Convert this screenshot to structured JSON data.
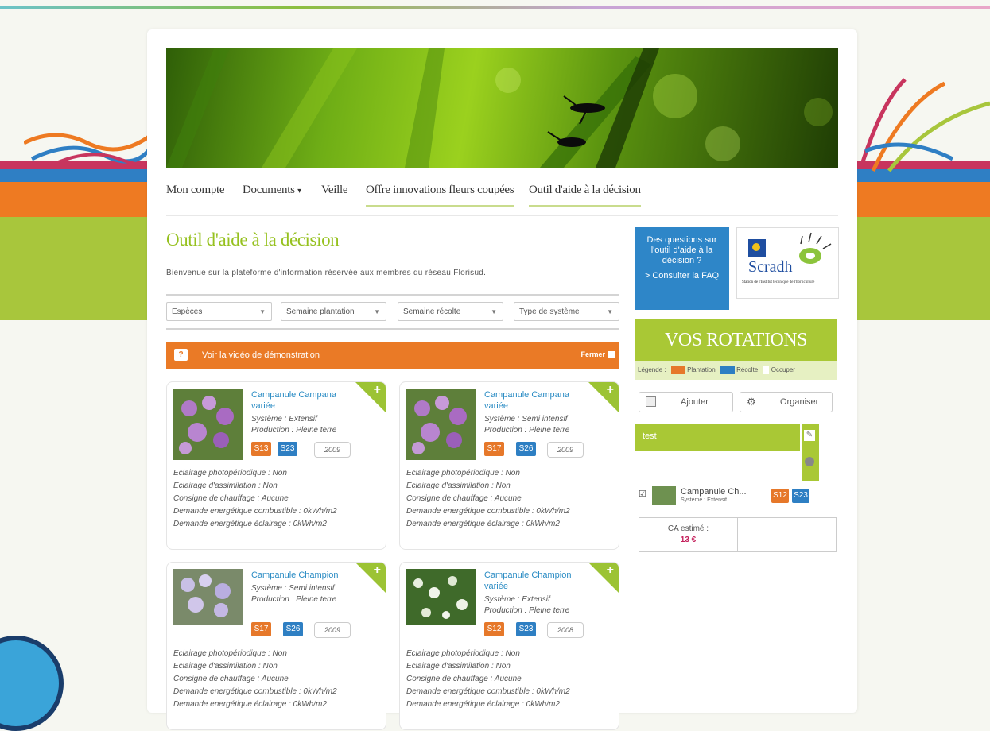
{
  "nav": {
    "items": [
      "Mon compte",
      "Documents",
      "Veille",
      "Offre innovations fleurs coupées",
      "Outil d'aide à la décision"
    ],
    "dropdown_caret": "▾"
  },
  "main": {
    "title": "Outil d'aide à la décision",
    "welcome": "Bienvenue sur la plateforme d'information réservée aux membres du réseau Florisud."
  },
  "filters": [
    "Espèces",
    "Semaine plantation",
    "Semaine récolte",
    "Type de système"
  ],
  "video": {
    "label": "Voir la vidéo de démonstration",
    "close": "Fermer"
  },
  "cards": [
    {
      "title": "Campanule Campana variée",
      "system": "Système : Extensif",
      "production": "Production : Pleine terre",
      "plant_week": "S13",
      "harvest_week": "S23",
      "year": "2009",
      "info": [
        "Eclairage photopériodique : Non",
        "Eclairage d'assimilation : Non",
        "Consigne de chauffage : Aucune",
        "Demande energétique combustible : 0kWh/m2",
        "Demande energétique éclairage : 0kWh/m2"
      ]
    },
    {
      "title": "Campanule Campana variée",
      "system": "Système : Semi intensif",
      "production": "Production : Pleine terre",
      "plant_week": "S17",
      "harvest_week": "S26",
      "year": "2009",
      "info": [
        "Eclairage photopériodique : Non",
        "Eclairage d'assimilation : Non",
        "Consigne de chauffage : Aucune",
        "Demande energétique combustible : 0kWh/m2",
        "Demande energétique éclairage : 0kWh/m2"
      ]
    },
    {
      "title": "Campanule Champion",
      "system": "Système : Semi intensif",
      "production": "Production : Pleine terre",
      "plant_week": "S17",
      "harvest_week": "S26",
      "year": "2009",
      "info": [
        "Eclairage photopériodique : Non",
        "Eclairage d'assimilation : Non",
        "Consigne de chauffage : Aucune",
        "Demande energétique combustible : 0kWh/m2",
        "Demande energétique éclairage : 0kWh/m2"
      ]
    },
    {
      "title": "Campanule Champion variée",
      "system": "Système : Extensif",
      "production": "Production : Pleine terre",
      "plant_week": "S12",
      "harvest_week": "S23",
      "year": "2008",
      "info": [
        "Eclairage photopériodique : Non",
        "Eclairage d'assimilation : Non",
        "Consigne de chauffage : Aucune",
        "Demande energétique combustible : 0kWh/m2",
        "Demande energétique éclairage : 0kWh/m2"
      ]
    }
  ],
  "sidebar": {
    "faq_text": "Des questions sur l'outil d'aide à la décision ?",
    "faq_link": "> Consulter la FAQ",
    "logo_name": "Scradh",
    "logo_sub": "Station de l'Institut technique de l'horticulture",
    "rotations_title": "VOS ROTATIONS",
    "legend_label": "Légende :",
    "legend_items": [
      "Plantation",
      "Récolte",
      "Occuper"
    ],
    "add_label": "Ajouter",
    "organize_label": "Organiser",
    "rotation_name": "test",
    "item_title": "Campanule Ch...",
    "item_system": "Système : Extensif",
    "item_plant": "S12",
    "item_harvest": "S23",
    "ca_label": "CA estimé :",
    "ca_value": "13 €"
  },
  "colors": {
    "accent_green": "#96c11f",
    "orange": "#ea7a26",
    "blue": "#2e86c8",
    "link_blue": "#2b8cc4",
    "price_red": "#c41e5a"
  },
  "icons": [
    "help-icon",
    "close-icon",
    "add-icon",
    "add-rotation-icon",
    "organize-icon",
    "edit-icon",
    "checkbox-icon"
  ]
}
